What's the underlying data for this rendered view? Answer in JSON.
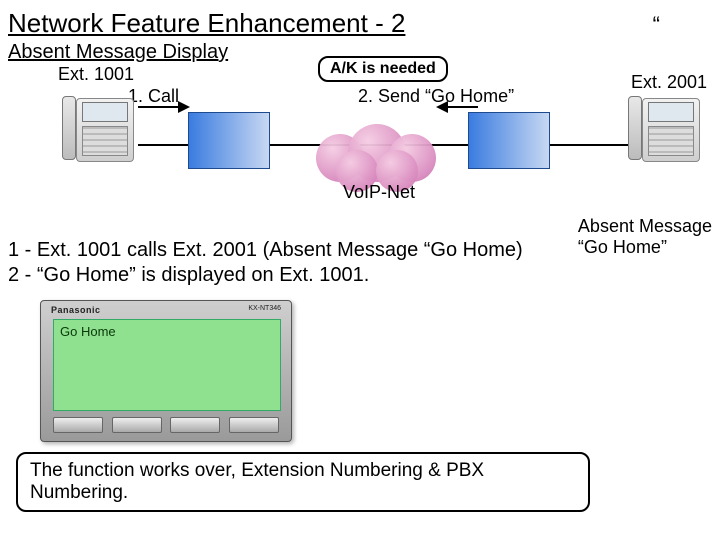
{
  "title": "Network Feature Enhancement - 2",
  "subtitle": "Absent Message Display",
  "quote": "“",
  "ext_left": "Ext. 1001",
  "ext_right": "Ext. 2001",
  "step1": "1. Call",
  "step2": "2. Send “Go Home”",
  "ak_needed": "A/K is needed",
  "cloud_label": "VoIP-Net",
  "absent_msg_title": "Absent Message",
  "absent_msg_value": "“Go Home”",
  "explain_line1": "1 - Ext. 1001 calls Ext. 2001 (Absent Message “Go Home)",
  "explain_line2": "2 - “Go Home” is displayed on Ext. 1001.",
  "phone_brand": "Panasonic",
  "phone_model": "KX-NT346",
  "lcd_message": "Go Home",
  "callout": "The function works over, Extension Numbering & PBX Numbering."
}
